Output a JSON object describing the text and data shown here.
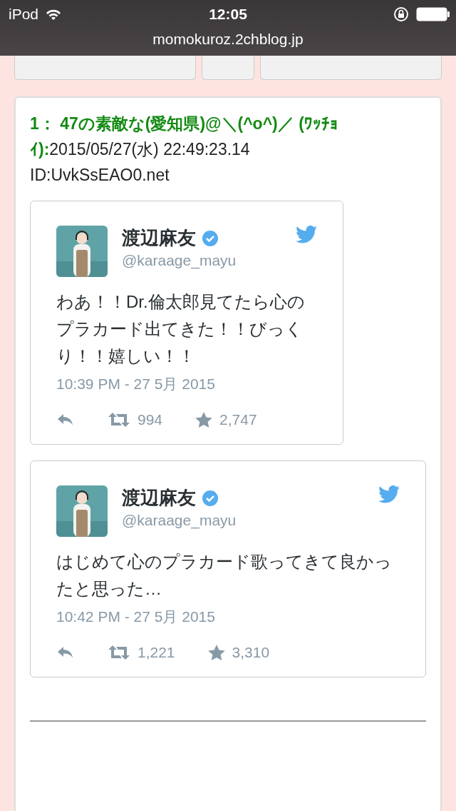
{
  "status_bar": {
    "carrier": "iPod",
    "time": "12:05",
    "url": "momokuroz.2chblog.jp"
  },
  "post": {
    "header": "**1：  47の素敵な(愛知県)@＼(^o^)／ (ﾜｯﾁｮｲ):**2015/05/27(水) 22:49:23.14",
    "id": "ID:UvkSsEAO0.net"
  },
  "tweets": [
    {
      "kind": "compact",
      "name": "渡辺麻友",
      "verified": true,
      "handle": "@karaage_mayu",
      "text": "わあ！！Dr.倫太郎見てたら心のプラカード出てきた！！びっくり！！嬉しい！！",
      "date": "10:39 PM - 27 5月 2015",
      "retweets": "994",
      "favorites": "2,747"
    },
    {
      "kind": "full",
      "name": "渡辺麻友",
      "verified": true,
      "handle": "@karaage_mayu",
      "text": "はじめて心のプラカード歌ってきて良かったと思った…",
      "date": "10:42 PM - 27 5月 2015",
      "retweets": "1,221",
      "favorites": "3,310"
    }
  ]
}
